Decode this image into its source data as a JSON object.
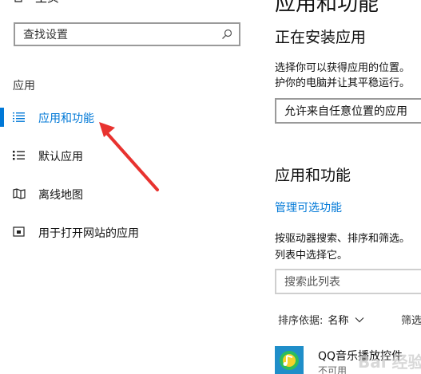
{
  "left": {
    "home_label": "主页",
    "search_placeholder": "查找设置",
    "section_label": "应用",
    "nav_items": [
      {
        "label": "应用和功能",
        "icon": "apps-list-icon",
        "active": true
      },
      {
        "label": "默认应用",
        "icon": "default-apps-icon",
        "active": false
      },
      {
        "label": "离线地图",
        "icon": "offline-map-icon",
        "active": false
      },
      {
        "label": "用于打开网站的应用",
        "icon": "open-website-icon",
        "active": false
      }
    ]
  },
  "right": {
    "title": "应用和功能",
    "install_heading": "正在安装应用",
    "install_desc_line1": "选择你可以获得应用的位置。",
    "install_desc_line2": "护你的电脑并让其平稳运行。",
    "install_select_value": "允许来自任意位置的应用",
    "apps_heading": "应用和功能",
    "manage_link": "管理可选功能",
    "apps_desc_line1": "按驱动器搜索、排序和筛选。",
    "apps_desc_line2": "列表中选择它。",
    "search_placeholder": "搜索此列表",
    "sort_label": "排序依据:",
    "sort_value": "名称",
    "filter_label": "筛选",
    "apps": [
      {
        "name": "QQ音乐播放控件",
        "status": "不可用"
      }
    ]
  },
  "watermark": "Bai 经验",
  "colors": {
    "accent": "#0078d7",
    "annotation_arrow": "#e8322f"
  }
}
